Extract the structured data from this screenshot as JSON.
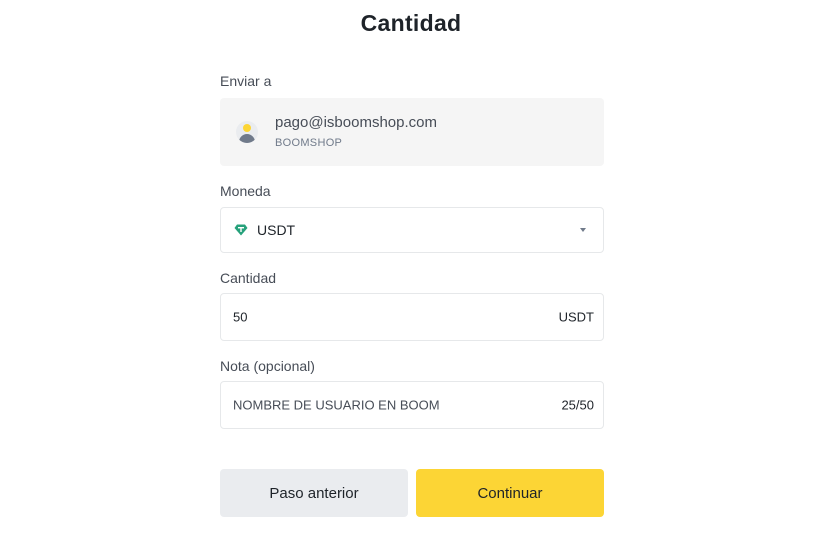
{
  "page": {
    "title": "Cantidad"
  },
  "send_to": {
    "label": "Enviar a",
    "email": "pago@isboomshop.com",
    "name": "BOOMSHOP",
    "avatar_icon": "user-avatar-icon"
  },
  "currency": {
    "label": "Moneda",
    "selected": "USDT",
    "icon": "tether-icon",
    "icon_color": "#26a17b"
  },
  "amount": {
    "label": "Cantidad",
    "value": "50",
    "unit": "USDT"
  },
  "note": {
    "label": "Nota (opcional)",
    "value": "NOMBRE DE USUARIO EN BOOM",
    "counter": "25/50"
  },
  "buttons": {
    "previous": "Paso anterior",
    "continue": "Continuar"
  },
  "colors": {
    "accent": "#fcd535",
    "secondary_button": "#eaecef",
    "recipient_bg": "#f5f5f5"
  }
}
